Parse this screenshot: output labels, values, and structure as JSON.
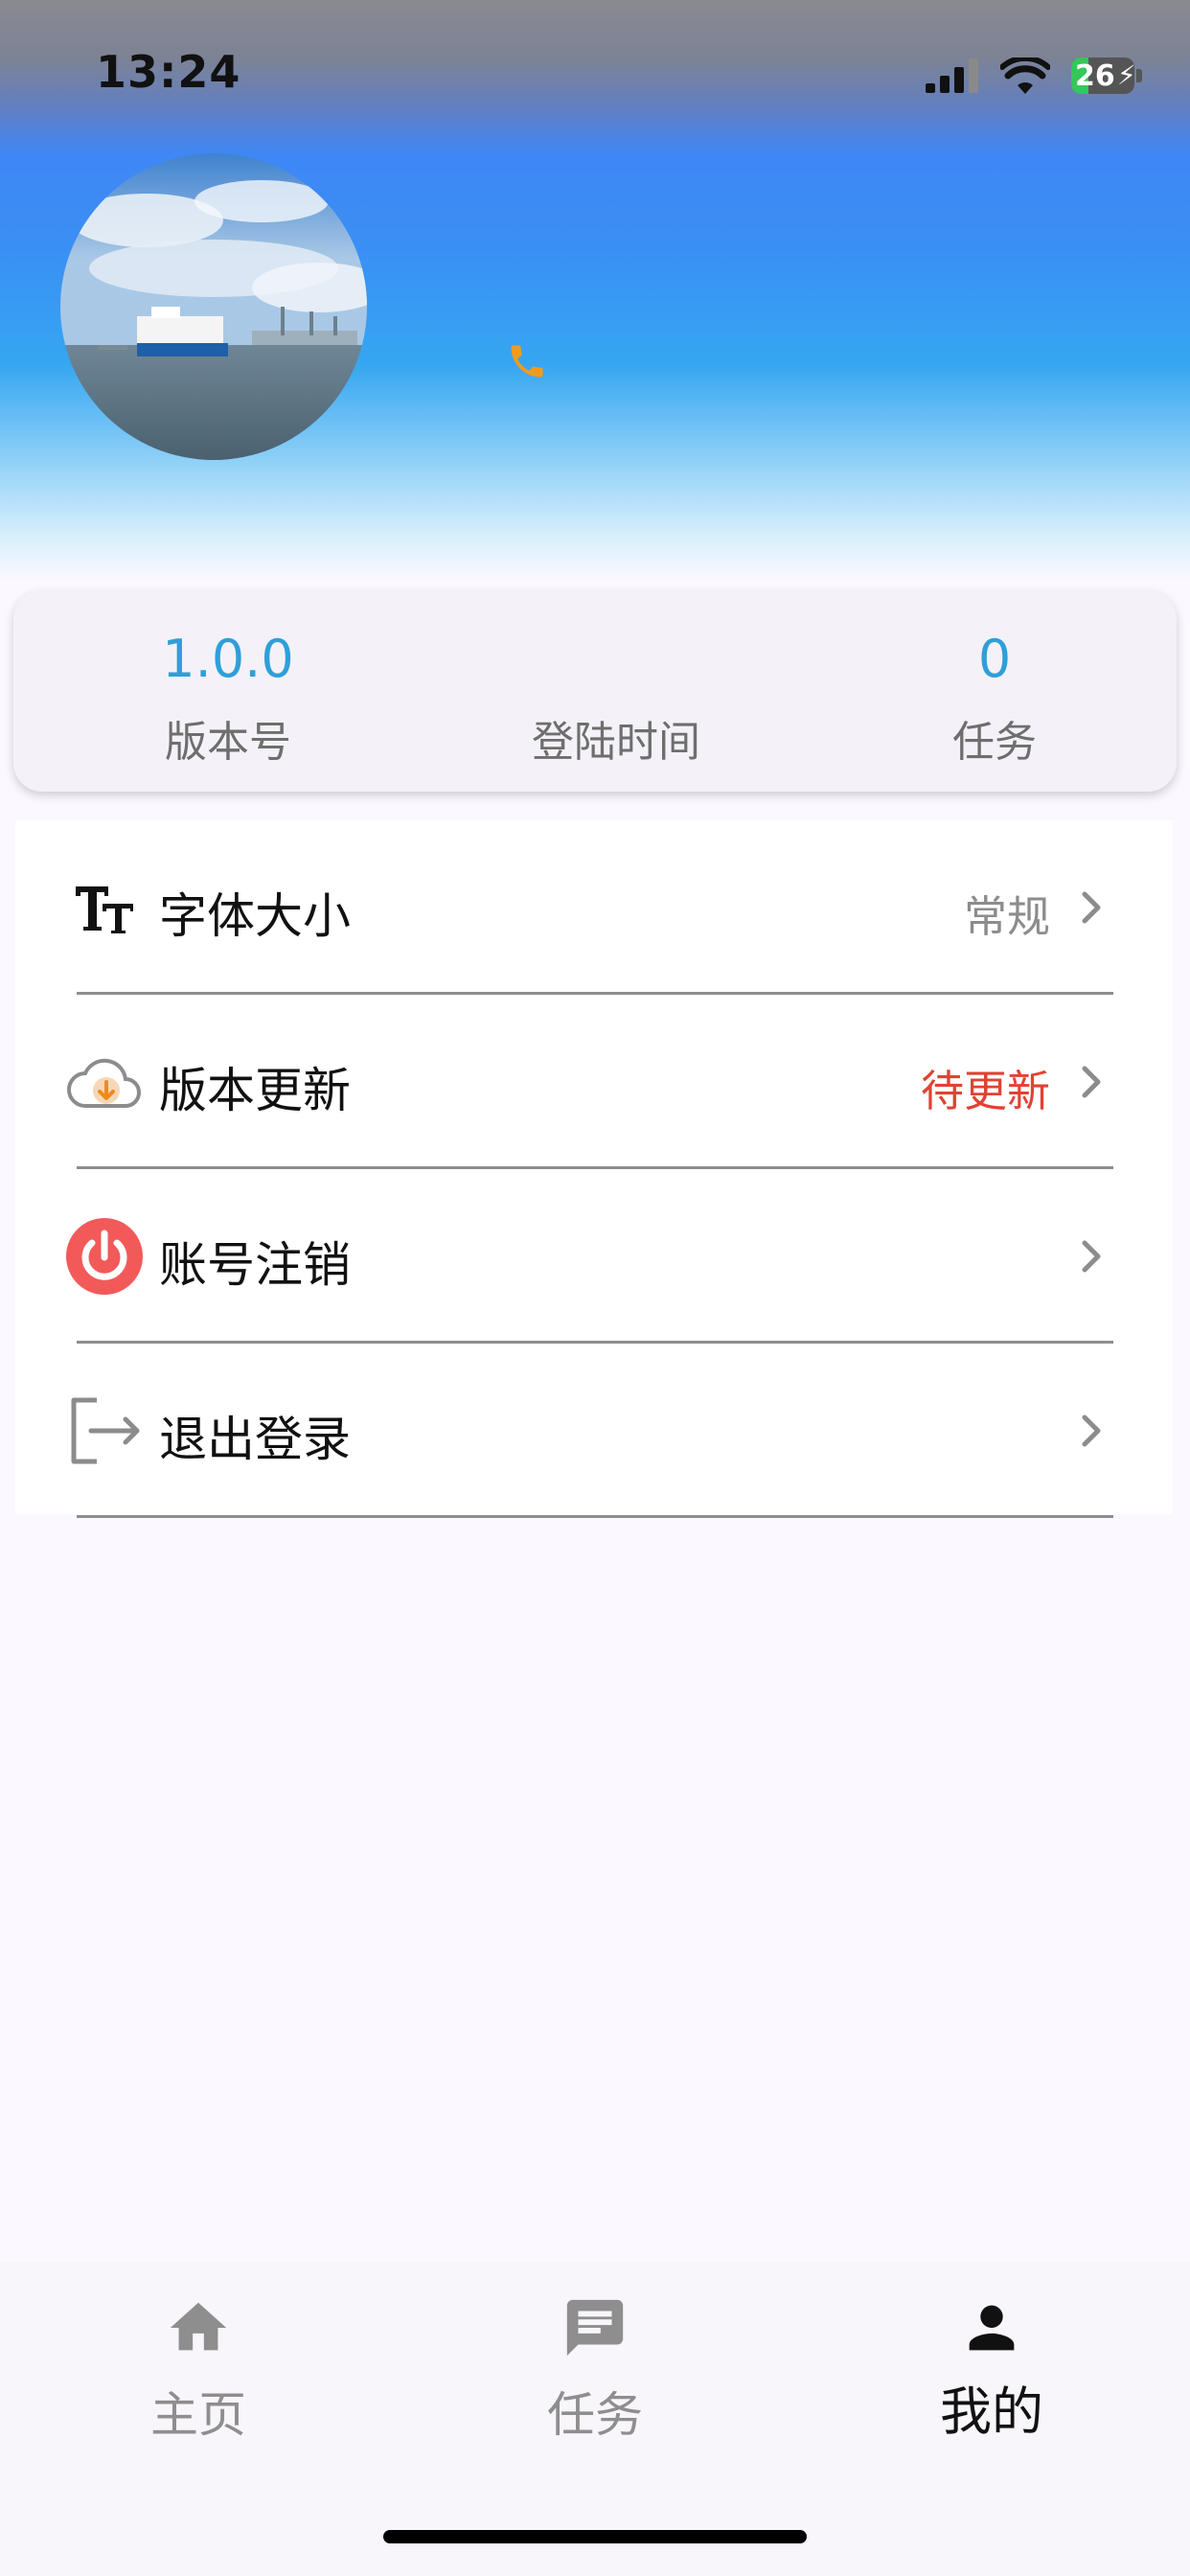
{
  "status_bar": {
    "time": "13:24",
    "battery": "26"
  },
  "stats": [
    {
      "value": "1.0.0",
      "label": "版本号"
    },
    {
      "value": "",
      "label": "登陆时间"
    },
    {
      "value": "0",
      "label": "任务"
    }
  ],
  "menu": [
    {
      "label": "字体大小",
      "value": "常规",
      "icon": "font-size-icon"
    },
    {
      "label": "版本更新",
      "value": "待更新",
      "icon": "cloud-download-icon"
    },
    {
      "label": "账号注销",
      "value": "",
      "icon": "power-icon"
    },
    {
      "label": "退出登录",
      "value": "",
      "icon": "logout-icon"
    }
  ],
  "tabs": [
    {
      "label": "主页",
      "icon": "home-icon",
      "active": false
    },
    {
      "label": "任务",
      "icon": "message-icon",
      "active": false
    },
    {
      "label": "我的",
      "icon": "person-icon",
      "active": true
    }
  ],
  "colors": {
    "accent": "#2f9fd9",
    "alert": "#e04234",
    "power": "#f25a5a",
    "phone": "#f39a1e"
  }
}
